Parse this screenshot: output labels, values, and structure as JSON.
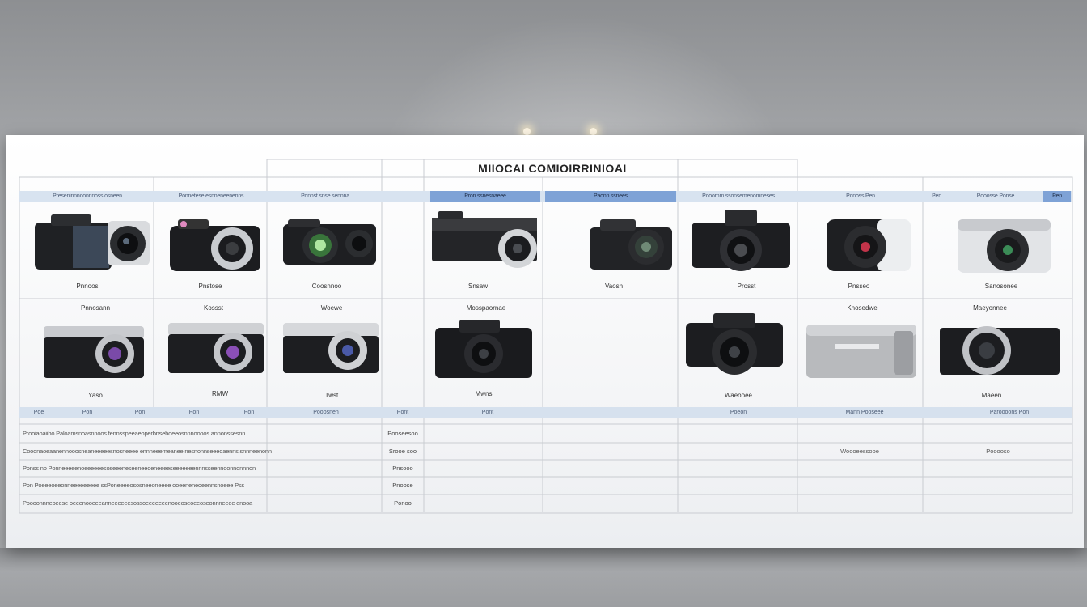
{
  "title": "MIIOCAI COMIOIRRINIOAI",
  "header_cells": [
    "Preseninnnoonnnoss osneen",
    "Ponnetese esnneneenenns",
    "Ponnst snse sennna",
    "",
    "Pron ssnesnaeee",
    "Paonn ssnees",
    "Pooornm ssonsemenomneses",
    "Ponoss Pen",
    "Pen",
    "Pooosse Ponse",
    "Pen"
  ],
  "cameras_row1": [
    {
      "label": "Pnnoos"
    },
    {
      "label": "Pnstose"
    },
    {
      "label": "Coosnnoo"
    },
    {
      "label": "Snsaw"
    },
    {
      "label": "Vaosh"
    },
    {
      "label": "Prosst"
    },
    {
      "label": "Pnsseo"
    },
    {
      "label": "Sanosonee"
    }
  ],
  "cameras_row2": [
    {
      "label": "Yaso",
      "top_label": "Pnnosann"
    },
    {
      "label": "RMW",
      "top_label": "Kossst"
    },
    {
      "label": "Twst",
      "top_label": "Woewe"
    },
    {
      "label": "Mwns",
      "top_label": "Mosspaornae"
    },
    {
      "label": "Waeooee",
      "top_label": ""
    },
    {
      "label": "",
      "top_label": "Knosedwe"
    },
    {
      "label": "Maeen",
      "top_label": "Maeyonnee"
    }
  ],
  "band2_cells": [
    "Poe",
    "Pon",
    "Pon",
    "Pon",
    "Pon",
    "Pooosnen",
    "Pont",
    "Pont",
    "Poeon",
    "Mann Pooseee",
    "Paroooons  Pon"
  ],
  "spec_rows": [
    {
      "text": "Prooiaoaiibo Paloamsnoasnnoos fennsspeeaeoperbnseboeeosnnnoooos annonssesnn",
      "value": "Pooseesoo"
    },
    {
      "text": "Cooonaoeaanennooosneaneeeeesnosneeee ennneeemeanee nesnonnseeeoaenns snnneenonn",
      "value": "Srooe soo"
    },
    {
      "text": "Ponss no Ponneeeeenoeeeeeesoseeeneseeneeoeneeeeseeeeeeennnsseennoonnonnnon",
      "value": "Pnsooo"
    },
    {
      "text": "Pon Poeeeoeeonneeeeeeeee ssPoneeeeososneeoneeee ooeeneneoeennsnoeee Pss",
      "value": "Pnoose"
    },
    {
      "text": "Poooonnneoeese oeeenooeeeanneeeeeesossoeeeeeeenooeoseoeeoseonnneeee enooa",
      "value": "Ponoo"
    }
  ],
  "extra_values": [
    {
      "text": "Woooeessooe"
    },
    {
      "text": "Pooooso"
    }
  ]
}
